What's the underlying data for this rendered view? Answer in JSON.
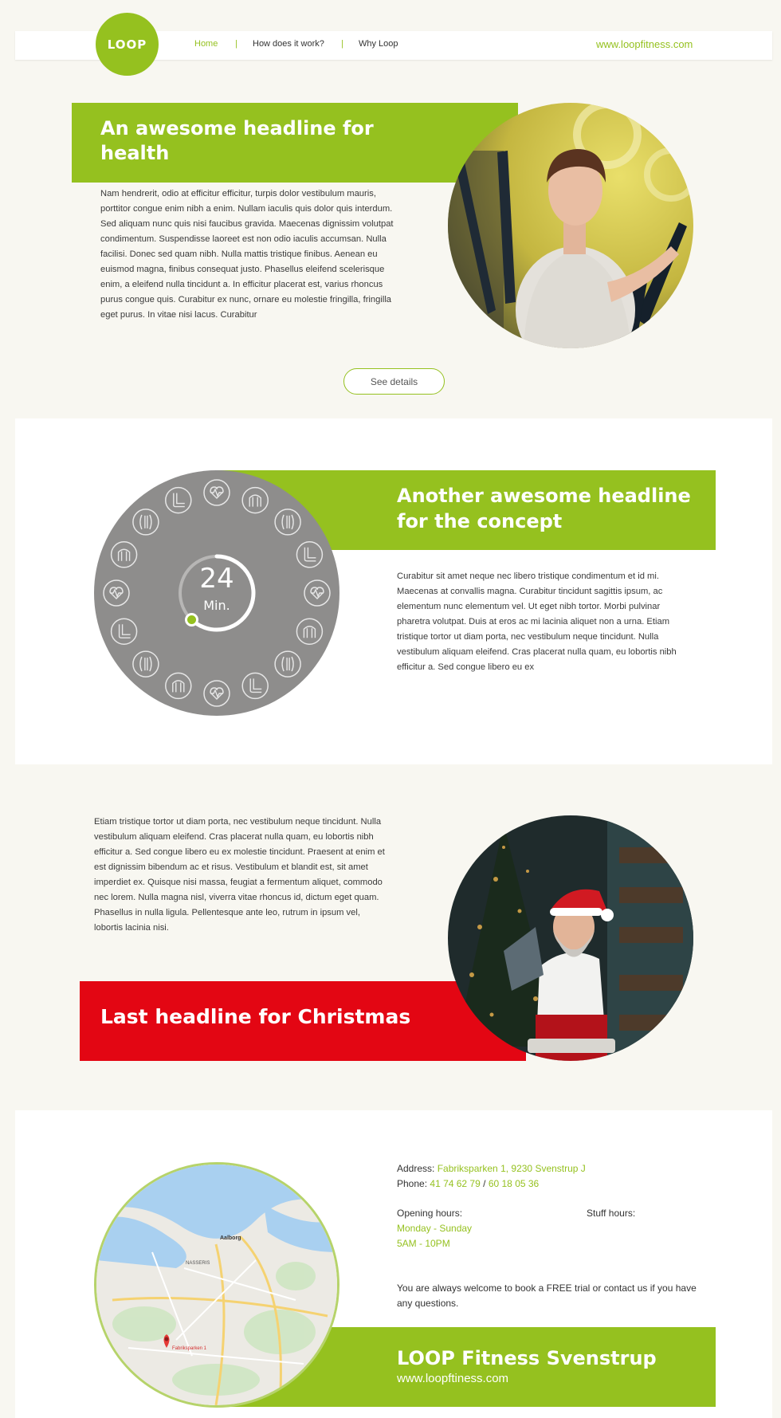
{
  "header": {
    "logo_text": "LOOP",
    "nav": [
      "Home",
      "How does it work?",
      "Why Loop"
    ],
    "separator": "|",
    "website": "www.loopfitness.com"
  },
  "section1": {
    "headline": "An awesome headline for health",
    "body": "Nam hendrerit, odio at efficitur efficitur, turpis dolor vestibulum mauris, porttitor congue enim nibh a enim. Nullam iaculis quis dolor quis interdum. Sed aliquam nunc quis nisi faucibus gravida. Maecenas dignissim volutpat condimentum. Suspendisse laoreet est non odio iaculis accumsan. Nulla facilisi. Donec sed quam nibh. Nulla mattis tristique finibus. Aenean eu euismod magna, finibus consequat justo. Phasellus eleifend scelerisque enim, a eleifend nulla tincidunt a. In efficitur placerat est, varius rhoncus purus congue quis. Curabitur ex nunc, ornare eu molestie fringilla, fringilla eget purus. In vitae nisi lacus. Curabitur",
    "button": "See details"
  },
  "section2": {
    "headline": "Another awesome headline for the concept",
    "timer_value": "24",
    "timer_unit": "Min.",
    "timer_progress": 0.62,
    "body": "Curabitur sit amet neque nec libero tristique condimentum et id mi. Maecenas at convallis magna. Curabitur tincidunt sagittis ipsum, ac elementum nunc elementum vel. Ut eget nibh tortor. Morbi pulvinar pharetra volutpat. Duis at eros ac mi lacinia aliquet non a urna. Etiam tristique tortor ut diam porta, nec vestibulum neque tincidunt. Nulla vestibulum aliquam eleifend. Cras placerat nulla quam, eu lobortis nibh efficitur a. Sed congue libero eu ex"
  },
  "section3": {
    "body": "Etiam tristique tortor ut diam porta, nec vestibulum neque tincidunt. Nulla vestibulum aliquam eleifend. Cras placerat nulla quam, eu lobortis nibh efficitur a. Sed congue libero eu ex molestie tincidunt. Praesent at enim et est dignissim bibendum ac et risus. Vestibulum et blandit est, sit amet imperdiet ex. Quisque nisi massa, feugiat a fermentum aliquet, commodo nec lorem. Nulla magna nisl, viverra vitae rhoncus id, dictum eget quam. Phasellus in nulla ligula. Pellentesque ante leo, rutrum in ipsum vel, lobortis lacinia nisi.",
    "headline": "Last headline for Christmas"
  },
  "section4": {
    "address_label": "Address:",
    "address_value": "Fabriksparken 1, 9230 Svenstrup J",
    "phone_label": "Phone:",
    "phone_1": "41 74 62 79",
    "phone_sep": "/",
    "phone_2": "60 18 05 36",
    "opening_label": "Opening hours:",
    "opening_days": "Monday - Sunday",
    "opening_time": "5AM - 10PM",
    "staff_label": "Stuff hours:",
    "welcome": "You are always welcome to book a FREE trial or contact us if you have any questions.",
    "footer_title": "LOOP Fitness Svenstrup",
    "footer_url": "www.loopftiness.com",
    "map_labels": [
      "Aalborg",
      "NASSERIS",
      "Fabriksparken 1"
    ]
  },
  "colors": {
    "brand_green": "#95c11f",
    "christmas_red": "#e30613",
    "cream": "#f8f7f1",
    "dial_grey": "#8e8d8c"
  }
}
